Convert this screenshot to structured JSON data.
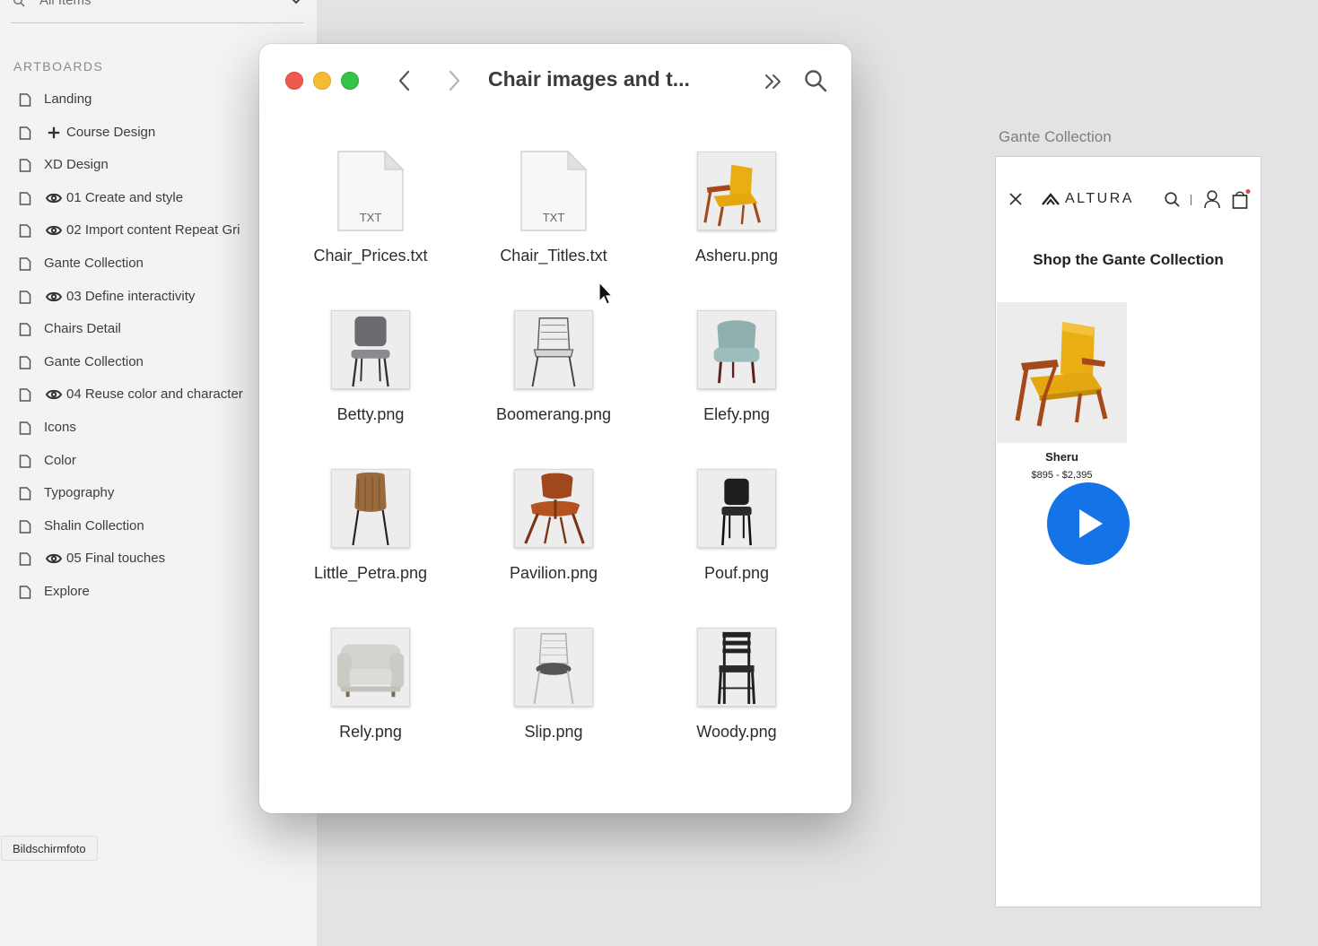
{
  "sidebar": {
    "search_text": "All Items",
    "section_title": "ARTBOARDS",
    "items": [
      {
        "label": "Landing",
        "prefix": ""
      },
      {
        "label": "Course Design",
        "prefix": "plus"
      },
      {
        "label": "XD Design",
        "prefix": ""
      },
      {
        "label": "01 Create and style",
        "prefix": "eye"
      },
      {
        "label": "02 Import content Repeat Gri",
        "prefix": "eye"
      },
      {
        "label": "Gante Collection",
        "prefix": ""
      },
      {
        "label": "03 Define interactivity",
        "prefix": "eye"
      },
      {
        "label": "Chairs Detail",
        "prefix": ""
      },
      {
        "label": "Gante Collection",
        "prefix": ""
      },
      {
        "label": "04 Reuse color and character",
        "prefix": "eye"
      },
      {
        "label": "Icons",
        "prefix": ""
      },
      {
        "label": "Color",
        "prefix": ""
      },
      {
        "label": "Typography",
        "prefix": ""
      },
      {
        "label": "Shalin Collection",
        "prefix": ""
      },
      {
        "label": "05 Final touches",
        "prefix": "eye"
      },
      {
        "label": "Explore",
        "prefix": ""
      }
    ],
    "tooltip": "Bildschirmfoto"
  },
  "finder": {
    "title": "Chair images and t...",
    "files": [
      {
        "name": "Chair_Prices.txt",
        "kind": "txt",
        "ext_label": "TXT"
      },
      {
        "name": "Chair_Titles.txt",
        "kind": "txt",
        "ext_label": "TXT"
      },
      {
        "name": "Asheru.png",
        "kind": "image",
        "icon": "yellow-lounge-chair-icon"
      },
      {
        "name": "Betty.png",
        "kind": "image",
        "icon": "grey-chair-icon"
      },
      {
        "name": "Boomerang.png",
        "kind": "image",
        "icon": "wire-chair-icon"
      },
      {
        "name": "Elefy.png",
        "kind": "image",
        "icon": "teal-armchair-icon"
      },
      {
        "name": "Little_Petra.png",
        "kind": "image",
        "icon": "wood-shell-chair-icon"
      },
      {
        "name": "Pavilion.png",
        "kind": "image",
        "icon": "molded-plywood-chair-icon"
      },
      {
        "name": "Pouf.png",
        "kind": "image",
        "icon": "black-chair-icon"
      },
      {
        "name": "Rely.png",
        "kind": "image",
        "icon": "sofa-armchair-icon"
      },
      {
        "name": "Slip.png",
        "kind": "image",
        "icon": "white-wire-chair-icon"
      },
      {
        "name": "Woody.png",
        "kind": "image",
        "icon": "black-slat-chair-icon"
      }
    ]
  },
  "artboard": {
    "label": "Gante Collection",
    "brand": "ALTURA",
    "heading": "Shop the Gante Collection",
    "product_name": "Sheru",
    "product_price": "$895 - $2,395"
  },
  "colors": {
    "accent": "#1473e6",
    "traffic_red": "#ee5a52",
    "traffic_yellow": "#f5bc33",
    "traffic_green": "#36c446"
  }
}
